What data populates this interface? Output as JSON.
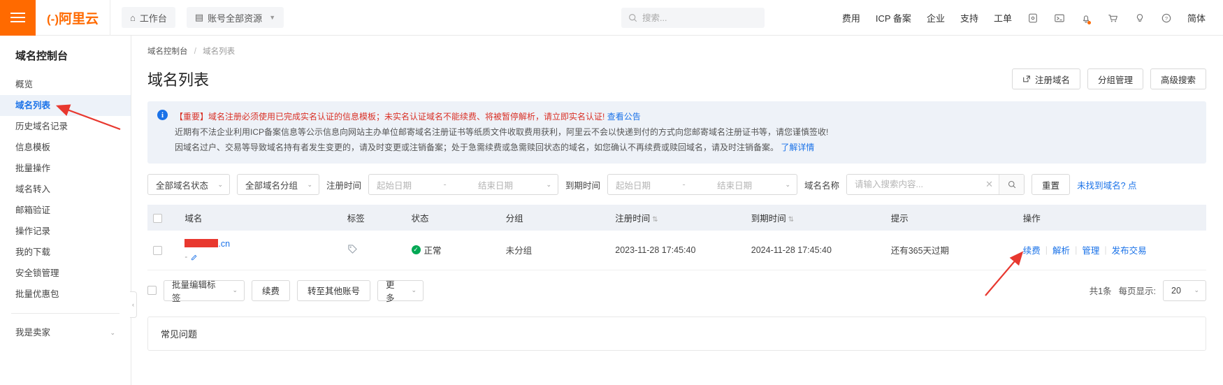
{
  "header": {
    "logo_text": "阿里云",
    "logo_bracket": "(-)",
    "workbench": "工作台",
    "resources": "账号全部资源",
    "search_placeholder": "搜索...",
    "links": [
      "费用",
      "ICP 备案",
      "企业",
      "支持",
      "工单"
    ],
    "lang": "简体",
    "icons": [
      "menu-icon",
      "home-icon",
      "grid-icon",
      "search-icon",
      "app-icon",
      "console-icon",
      "bell-icon",
      "cart-icon",
      "bulb-icon",
      "help-icon"
    ]
  },
  "sidebar": {
    "title": "域名控制台",
    "items": [
      {
        "label": "概览",
        "active": false
      },
      {
        "label": "域名列表",
        "active": true
      },
      {
        "label": "历史域名记录",
        "active": false
      },
      {
        "label": "信息模板",
        "active": false
      },
      {
        "label": "批量操作",
        "active": false
      },
      {
        "label": "域名转入",
        "active": false
      },
      {
        "label": "邮箱验证",
        "active": false
      },
      {
        "label": "操作记录",
        "active": false
      },
      {
        "label": "我的下载",
        "active": false
      },
      {
        "label": "安全锁管理",
        "active": false
      },
      {
        "label": "批量优惠包",
        "active": false
      }
    ],
    "group": "我是卖家"
  },
  "breadcrumb": {
    "parent": "域名控制台",
    "sep": "/",
    "current": "域名列表"
  },
  "page": {
    "title": "域名列表"
  },
  "title_actions": [
    {
      "label": "注册域名",
      "icon": "external-link-icon"
    },
    {
      "label": "分组管理",
      "icon": ""
    },
    {
      "label": "高级搜索",
      "icon": ""
    }
  ],
  "notice": {
    "line1_red": "【重要】域名注册必须使用已完成实名认证的信息模板；未实名认证域名不能续费、将被暂停解析，请立即实名认证!",
    "line1_link": "查看公告",
    "line2": "近期有不法企业利用ICP备案信息等公示信息向网站主办单位邮寄域名注册证书等纸质文件收取费用获利，阿里云不会以快递到付的方式向您邮寄域名注册证书等，请您谨慎签收!",
    "line3": "因域名过户、交易等导致域名持有者发生变更的，请及时变更或注销备案；处于急需续费或急需赎回状态的域名，如您确认不再续费或赎回域名，请及时注销备案。",
    "line3_link": "了解详情"
  },
  "filters": {
    "status_select": "全部域名状态",
    "group_select": "全部域名分组",
    "reg_time_label": "注册时间",
    "exp_time_label": "到期时间",
    "date_start_ph": "起始日期",
    "date_end_ph": "结束日期",
    "domain_name_label": "域名名称",
    "domain_search_ph": "请输入搜索内容...",
    "reset_label": "重置",
    "not_found_link": "未找到域名? 点"
  },
  "table": {
    "columns": [
      "域名",
      "标签",
      "状态",
      "分组",
      "注册时间",
      "到期时间",
      "提示",
      "操作"
    ],
    "sortable": [
      "注册时间",
      "到期时间"
    ],
    "rows": [
      {
        "domain_redacted": "",
        "domain_suffix": ".cn",
        "domain_sub": "-",
        "tag_icon": "tag-icon",
        "status": "正常",
        "group": "未分组",
        "reg_time": "2023-11-28 17:45:40",
        "exp_time": "2024-11-28 17:45:40",
        "hint": "还有365天过期",
        "actions": [
          "续费",
          "解析",
          "管理",
          "发布交易"
        ]
      }
    ]
  },
  "bulk": {
    "edit_tags": "批量编辑标签",
    "renew": "续费",
    "transfer": "转至其他账号",
    "more": "更多"
  },
  "pagination": {
    "total": "共1条",
    "per_page_label": "每页显示:",
    "per_page_value": "20"
  },
  "faq": {
    "title": "常见问题"
  },
  "colors": {
    "brand_orange": "#ff6a00",
    "link_blue": "#1a72e8",
    "alert_red": "#d93026",
    "success_green": "#00a854",
    "annotation_red": "#e8382f"
  }
}
